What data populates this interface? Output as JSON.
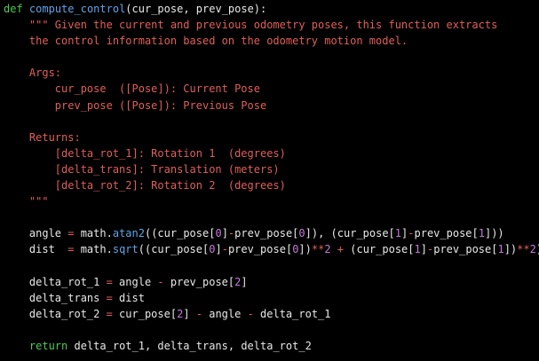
{
  "colors": {
    "background": "#000000",
    "keyword": "#4ec958",
    "function": "#5ea4e8",
    "text": "#e8e8e8",
    "string": "#e05f57",
    "operator": "#e05f57",
    "number": "#c678dd"
  },
  "code_lines": [
    [
      {
        "t": "def",
        "k": "kw"
      },
      {
        "t": " ",
        "k": "text"
      },
      {
        "t": "compute_control",
        "k": "fn"
      },
      {
        "t": "(cur_pose, prev_pose):",
        "k": "text"
      }
    ],
    [
      {
        "t": "    \"\"\" Given the current and previous odometry poses, this function extracts",
        "k": "str"
      }
    ],
    [
      {
        "t": "    the control information based on the odometry motion model.",
        "k": "str"
      }
    ],
    [
      {
        "t": "",
        "k": "text"
      }
    ],
    [
      {
        "t": "    Args:",
        "k": "str"
      }
    ],
    [
      {
        "t": "        cur_pose  ([Pose]): Current Pose",
        "k": "str"
      }
    ],
    [
      {
        "t": "        prev_pose ([Pose]): Previous Pose",
        "k": "str"
      }
    ],
    [
      {
        "t": "",
        "k": "text"
      }
    ],
    [
      {
        "t": "    Returns:",
        "k": "str"
      }
    ],
    [
      {
        "t": "        [delta_rot_1]: Rotation 1  (degrees)",
        "k": "str"
      }
    ],
    [
      {
        "t": "        [delta_trans]: Translation (meters)",
        "k": "str"
      }
    ],
    [
      {
        "t": "        [delta_rot_2]: Rotation 2  (degrees)",
        "k": "str"
      }
    ],
    [
      {
        "t": "    \"\"\"",
        "k": "str"
      }
    ],
    [
      {
        "t": "",
        "k": "text"
      }
    ],
    [
      {
        "t": "    angle ",
        "k": "text"
      },
      {
        "t": "=",
        "k": "op"
      },
      {
        "t": " math.",
        "k": "text"
      },
      {
        "t": "atan2",
        "k": "builtin"
      },
      {
        "t": "((cur_pose[",
        "k": "text"
      },
      {
        "t": "0",
        "k": "num"
      },
      {
        "t": "]",
        "k": "text"
      },
      {
        "t": "-",
        "k": "op"
      },
      {
        "t": "prev_pose[",
        "k": "text"
      },
      {
        "t": "0",
        "k": "num"
      },
      {
        "t": "]), (cur_pose[",
        "k": "text"
      },
      {
        "t": "1",
        "k": "num"
      },
      {
        "t": "]",
        "k": "text"
      },
      {
        "t": "-",
        "k": "op"
      },
      {
        "t": "prev_pose[",
        "k": "text"
      },
      {
        "t": "1",
        "k": "num"
      },
      {
        "t": "]))",
        "k": "text"
      }
    ],
    [
      {
        "t": "    dist  ",
        "k": "text"
      },
      {
        "t": "=",
        "k": "op"
      },
      {
        "t": " math.",
        "k": "text"
      },
      {
        "t": "sqrt",
        "k": "builtin"
      },
      {
        "t": "((cur_pose[",
        "k": "text"
      },
      {
        "t": "0",
        "k": "num"
      },
      {
        "t": "]",
        "k": "text"
      },
      {
        "t": "-",
        "k": "op"
      },
      {
        "t": "prev_pose[",
        "k": "text"
      },
      {
        "t": "0",
        "k": "num"
      },
      {
        "t": "])",
        "k": "text"
      },
      {
        "t": "**",
        "k": "op"
      },
      {
        "t": "2",
        "k": "num"
      },
      {
        "t": " ",
        "k": "text"
      },
      {
        "t": "+",
        "k": "op"
      },
      {
        "t": " (cur_pose[",
        "k": "text"
      },
      {
        "t": "1",
        "k": "num"
      },
      {
        "t": "]",
        "k": "text"
      },
      {
        "t": "-",
        "k": "op"
      },
      {
        "t": "prev_pose[",
        "k": "text"
      },
      {
        "t": "1",
        "k": "num"
      },
      {
        "t": "])",
        "k": "text"
      },
      {
        "t": "**",
        "k": "op"
      },
      {
        "t": "2",
        "k": "num"
      },
      {
        "t": ")",
        "k": "text"
      }
    ],
    [
      {
        "t": "",
        "k": "text"
      }
    ],
    [
      {
        "t": "    delta_rot_1 ",
        "k": "text"
      },
      {
        "t": "=",
        "k": "op"
      },
      {
        "t": " angle ",
        "k": "text"
      },
      {
        "t": "-",
        "k": "op"
      },
      {
        "t": " prev_pose[",
        "k": "text"
      },
      {
        "t": "2",
        "k": "num"
      },
      {
        "t": "]",
        "k": "text"
      }
    ],
    [
      {
        "t": "    delta_trans ",
        "k": "text"
      },
      {
        "t": "=",
        "k": "op"
      },
      {
        "t": " dist",
        "k": "text"
      }
    ],
    [
      {
        "t": "    delta_rot_2 ",
        "k": "text"
      },
      {
        "t": "=",
        "k": "op"
      },
      {
        "t": " cur_pose[",
        "k": "text"
      },
      {
        "t": "2",
        "k": "num"
      },
      {
        "t": "] ",
        "k": "text"
      },
      {
        "t": "-",
        "k": "op"
      },
      {
        "t": " angle ",
        "k": "text"
      },
      {
        "t": "-",
        "k": "op"
      },
      {
        "t": " delta_rot_1",
        "k": "text"
      }
    ],
    [
      {
        "t": "",
        "k": "text"
      }
    ],
    [
      {
        "t": "    ",
        "k": "text"
      },
      {
        "t": "return",
        "k": "kw"
      },
      {
        "t": " delta_rot_1, delta_trans, delta_rot_2",
        "k": "text"
      }
    ]
  ]
}
